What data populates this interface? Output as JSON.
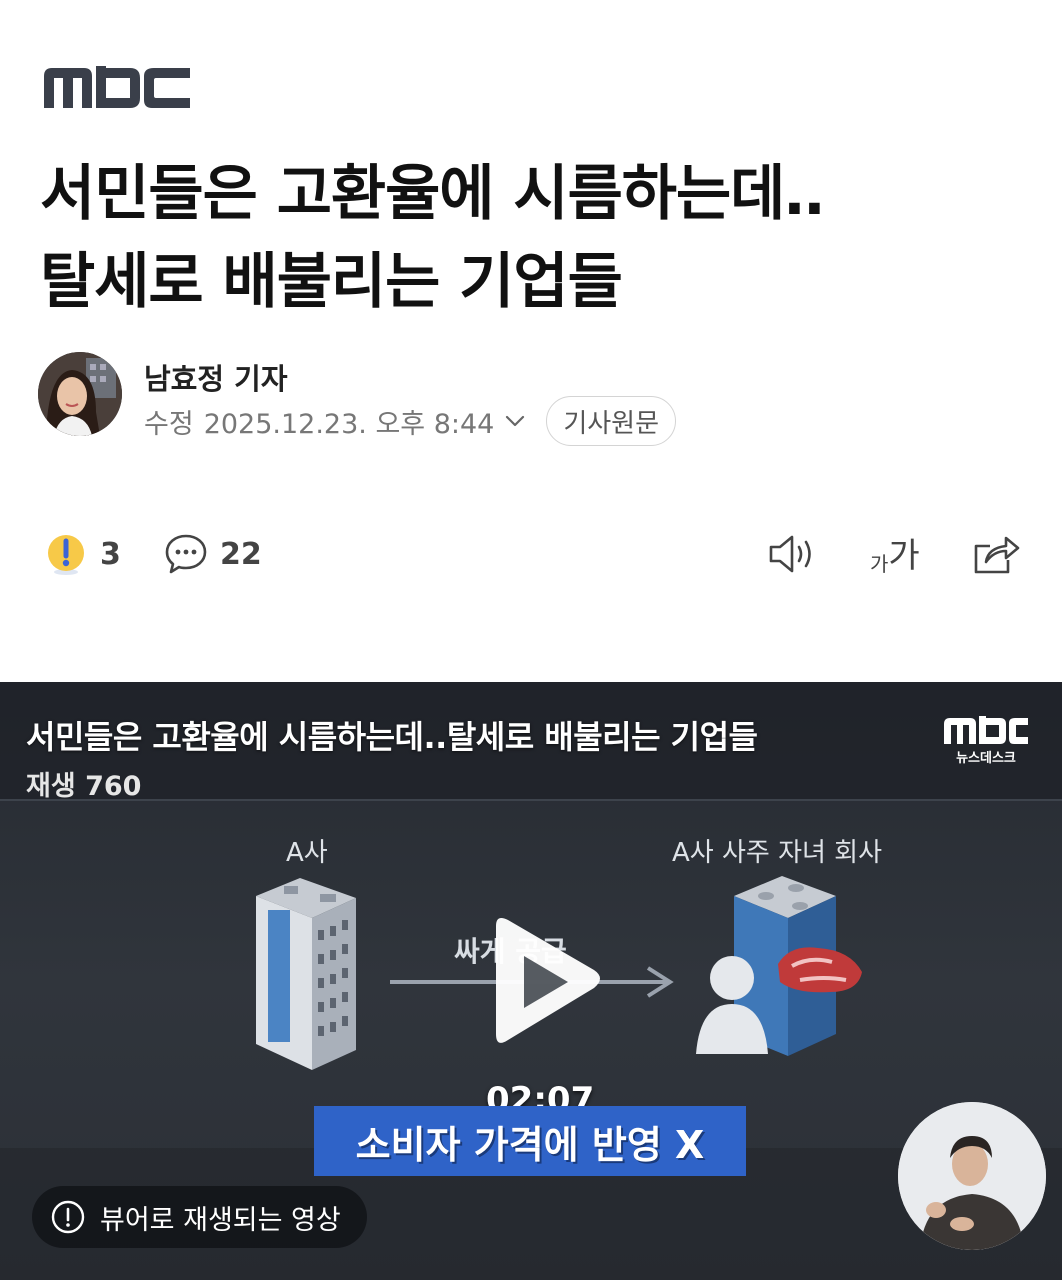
{
  "brand": {
    "logo_text": "MBC"
  },
  "article": {
    "headline_line1": "서민들은 고환율에 시름하는데‥",
    "headline_line2": "탈세로 배불리는 기업들"
  },
  "author": {
    "name": "남효정 기자",
    "modified_label": "수정",
    "modified_datetime": "2025.12.23. 오후 8:44",
    "original_button": "기사원문"
  },
  "actions": {
    "reaction_count": "3",
    "comment_count": "22",
    "icons": [
      "reaction-icon",
      "comment-icon",
      "tts-speaker-icon",
      "font-size-icon",
      "share-icon"
    ],
    "font_size_label_small": "가",
    "font_size_label_large": "가"
  },
  "video": {
    "title": "서민들은 고환율에 시름하는데..탈세로 배불리는 기업들",
    "views": "재생 760",
    "channel_logo": "MBC",
    "channel_sub": "뉴스데스크",
    "scene_label_left": "A사",
    "scene_label_right": "A사 사주 자녀 회사",
    "scene_arrow_text": "싸게 공급",
    "duration": "02:07",
    "caption": "소비자 가격에 반영 X",
    "viewer_notice": "뷰어로 재생되는 영상",
    "colors": {
      "caption_bg": "#2f63c8",
      "background": "#2b2f36"
    }
  }
}
